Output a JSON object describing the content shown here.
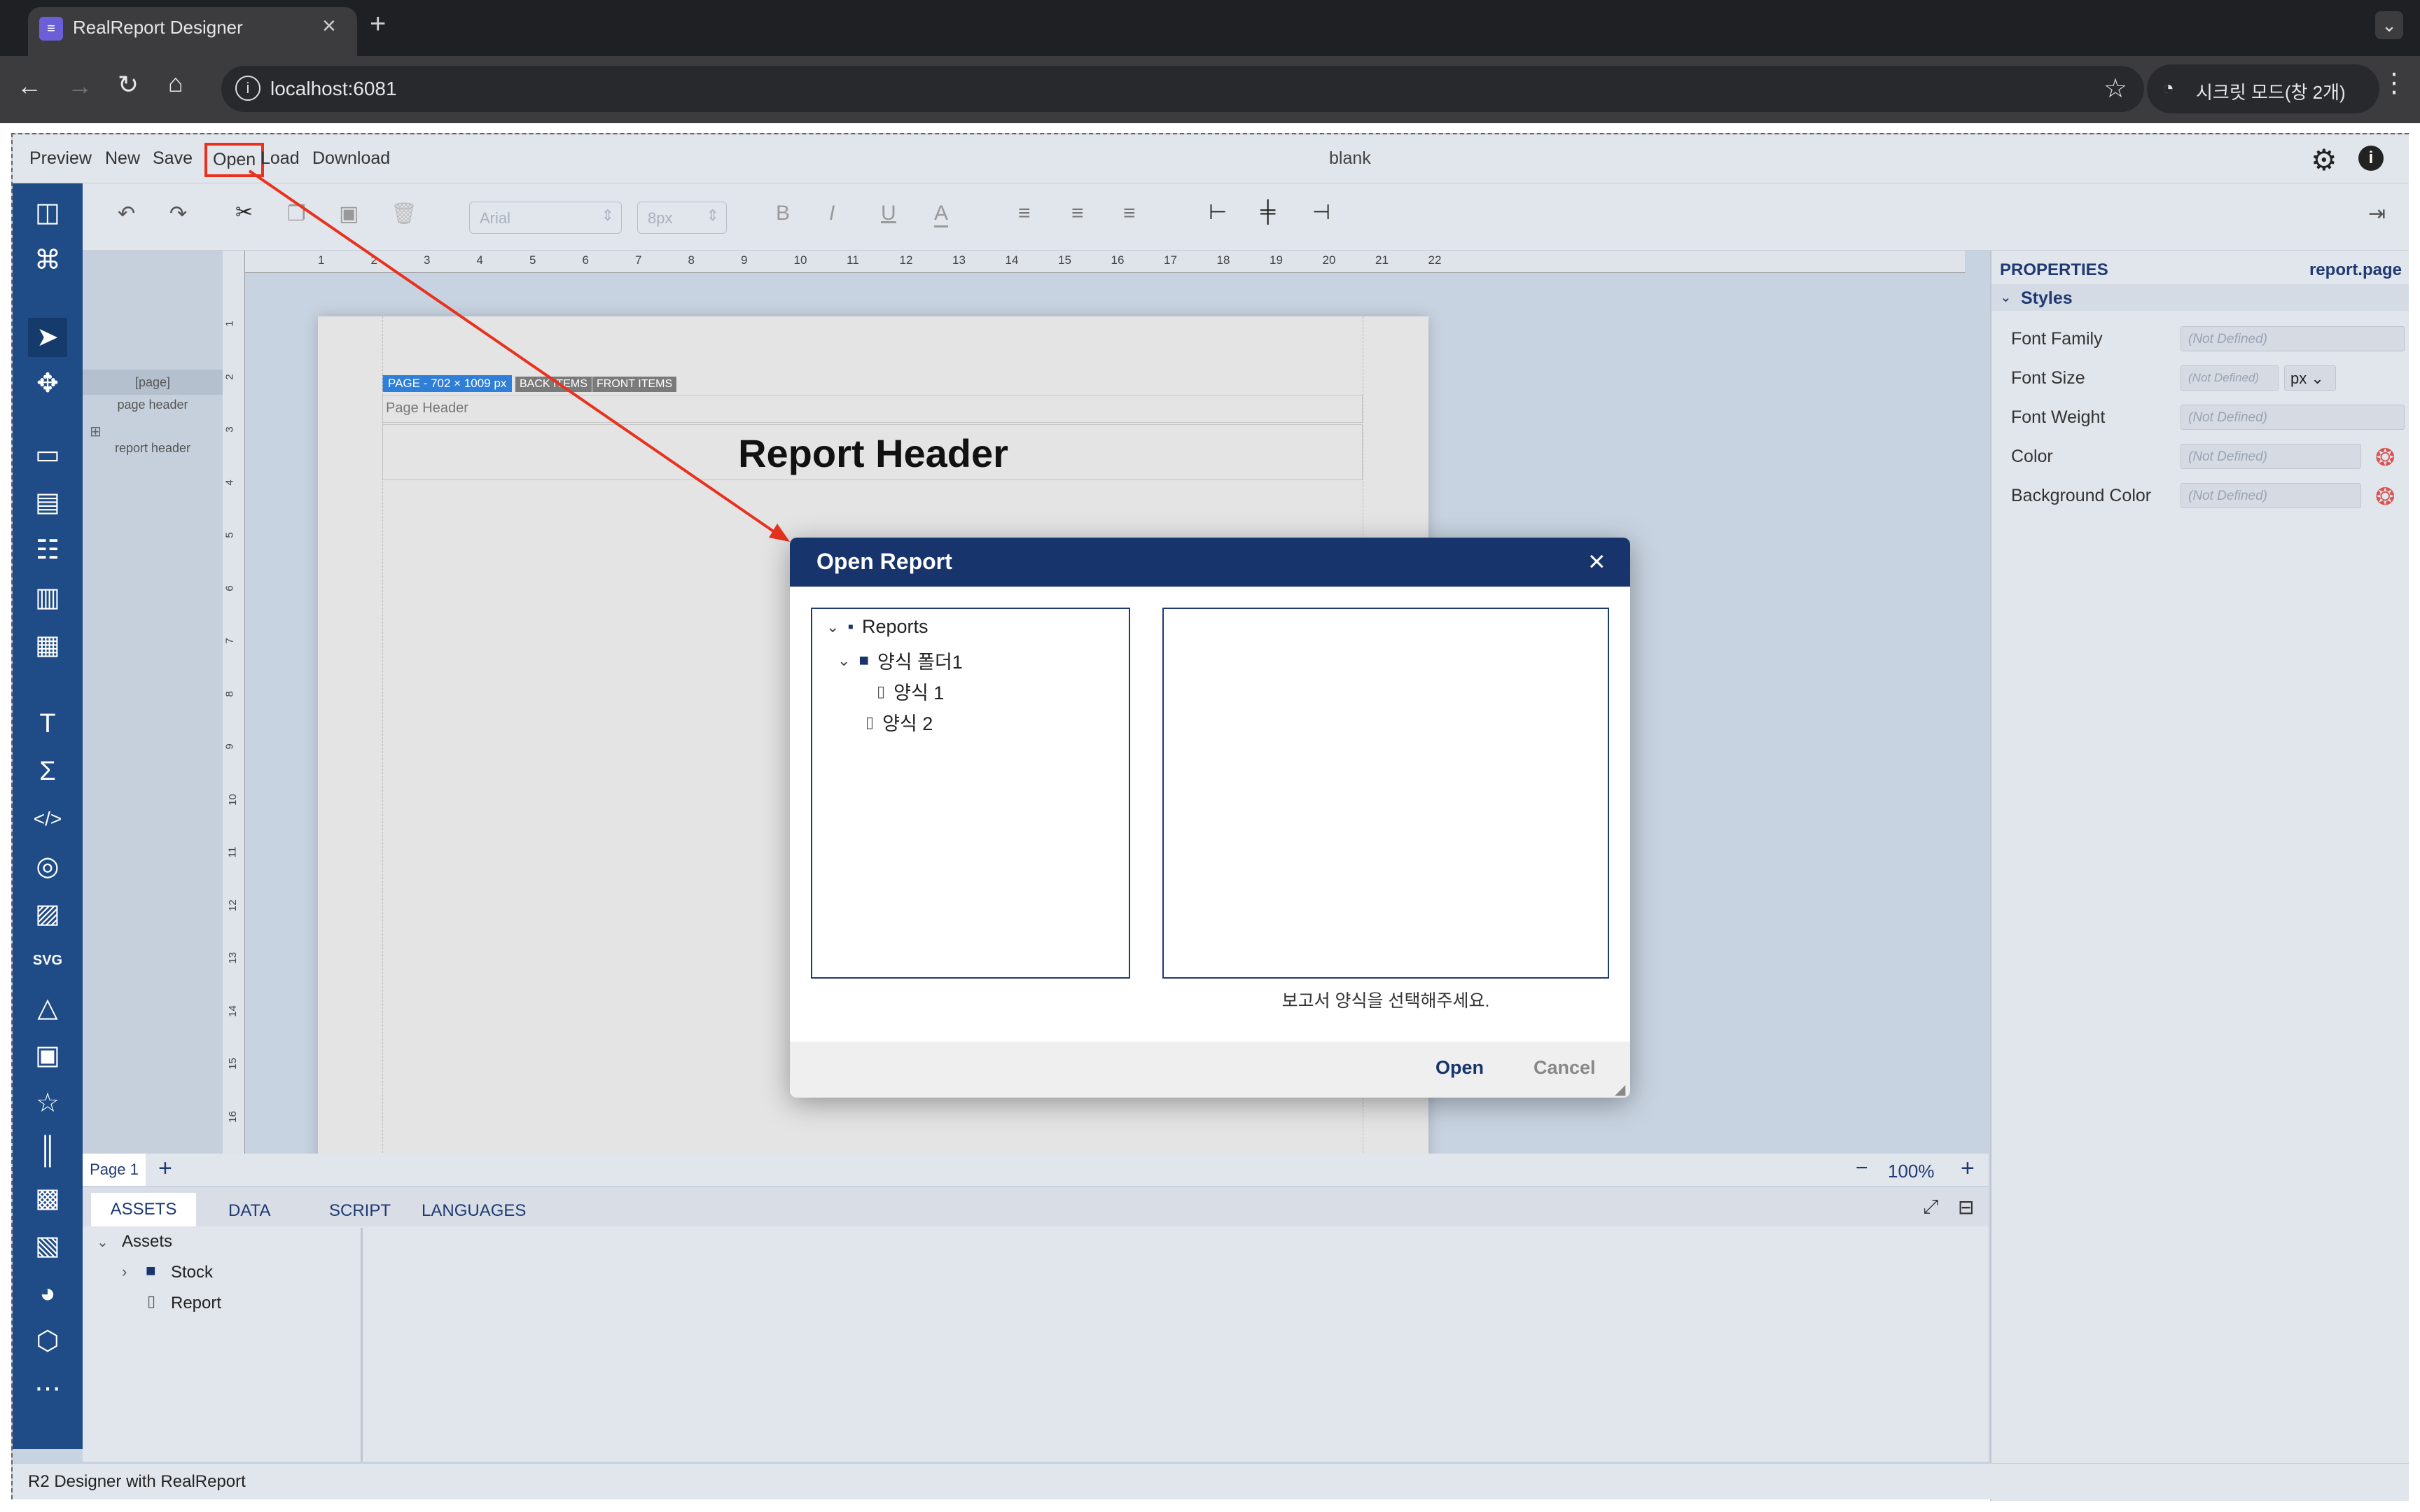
{
  "browser": {
    "tab_title": "RealReport Designer",
    "url": "localhost:6081",
    "incognito_label": "시크릿 모드(창 2개)"
  },
  "menu": {
    "items": [
      "Preview",
      "New",
      "Save",
      "Open",
      "Load",
      "Download"
    ],
    "highlighted": "Open",
    "doc_title": "blank"
  },
  "toolbar": {
    "font_family_placeholder": "Arial",
    "font_size_placeholder": "8px"
  },
  "outline": {
    "items": [
      "[page]",
      "page header",
      "report header"
    ]
  },
  "ruler": {
    "top_ticks": [
      "1",
      "2",
      "3",
      "4",
      "5",
      "6",
      "7",
      "8",
      "9",
      "10",
      "11",
      "12",
      "13",
      "14",
      "15",
      "16",
      "17",
      "18",
      "19",
      "20",
      "21",
      "22"
    ],
    "left_ticks": [
      "1",
      "2",
      "3",
      "4",
      "5",
      "6",
      "7",
      "8",
      "9",
      "10",
      "11",
      "12",
      "13",
      "14",
      "15",
      "16"
    ]
  },
  "page": {
    "badge": "PAGE - 702 × 1009 px",
    "back_items": "BACK ITEMS",
    "front_items": "FRONT ITEMS",
    "page_header_label": "Page Header",
    "report_header_text": "Report Header"
  },
  "properties": {
    "title": "PROPERTIES",
    "target": "report.page",
    "section": "Styles",
    "rows": [
      {
        "label": "Font Family",
        "value": "(Not Defined)"
      },
      {
        "label": "Font Size",
        "value": "(Not Defined)",
        "unit": "px"
      },
      {
        "label": "Font Weight",
        "value": "(Not Defined)"
      },
      {
        "label": "Color",
        "value": "(Not Defined)"
      },
      {
        "label": "Background Color",
        "value": "(Not Defined)"
      }
    ]
  },
  "pagebar": {
    "page_tab": "Page 1",
    "add": "+",
    "zoom_minus": "−",
    "zoom": "100%",
    "zoom_plus": "+"
  },
  "bottom": {
    "tabs": [
      "ASSETS",
      "DATA",
      "SCRIPT",
      "LANGUAGES"
    ],
    "active_tab": "ASSETS",
    "tree_root": "Assets",
    "tree_items": [
      "Stock",
      "Report"
    ]
  },
  "status": {
    "text": "R2 Designer with RealReport"
  },
  "modal": {
    "title": "Open Report",
    "tree": [
      {
        "label": "Reports",
        "level": 0,
        "kind": "folder-root"
      },
      {
        "label": "양식 폴더1",
        "level": 1,
        "kind": "folder"
      },
      {
        "label": "양식 1",
        "level": 2,
        "kind": "file"
      },
      {
        "label": "양식 2",
        "level": 1,
        "kind": "file"
      }
    ],
    "hint": "보고서 양식을 선택해주세요.",
    "open_button": "Open",
    "cancel_button": "Cancel"
  },
  "colors": {
    "sidebar": "#1f4b86",
    "modal_header": "#17346d",
    "annotation_red": "#e8321e"
  }
}
